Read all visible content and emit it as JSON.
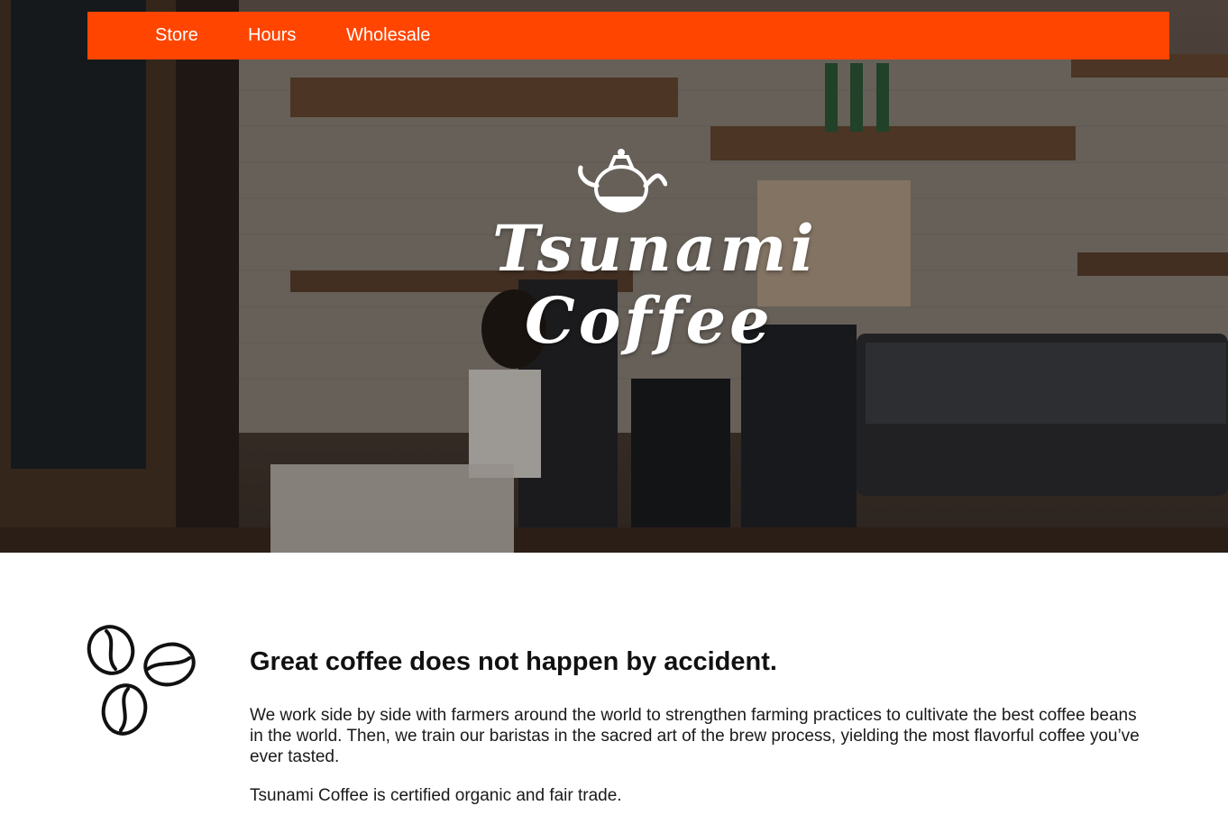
{
  "nav": {
    "items": [
      {
        "label": "Store"
      },
      {
        "label": "Hours"
      },
      {
        "label": "Wholesale"
      }
    ],
    "background": "#ff4500"
  },
  "hero": {
    "brand_line1": "Tsunami",
    "brand_line2": "Coffee",
    "icon": "kettle-icon"
  },
  "about": {
    "icon": "coffee-beans-icon",
    "heading": "Great coffee does not happen by accident.",
    "paragraph1": "We work side by side with farmers around the world to strengthen farming practices to cultivate the best coffee beans in the world. Then, we train our baristas in the sacred art of the brew process, yielding the most flavorful coffee you’ve ever tasted.",
    "paragraph2": "Tsunami Coffee is certified organic and fair trade."
  },
  "colors": {
    "accent": "#ff4500",
    "hero_overlay": "#3e322b"
  }
}
